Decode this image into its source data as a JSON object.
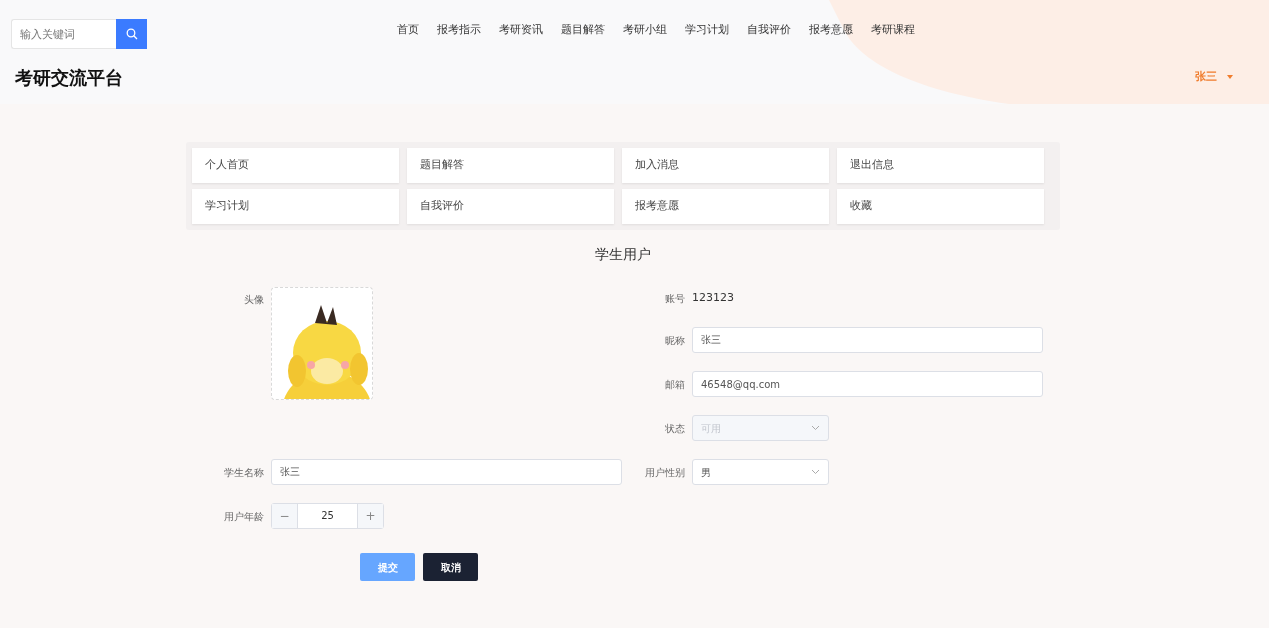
{
  "header": {
    "search": {
      "placeholder": "输入关键词"
    },
    "nav": [
      {
        "label": "首页"
      },
      {
        "label": "报考指示"
      },
      {
        "label": "考研资讯"
      },
      {
        "label": "题目解答"
      },
      {
        "label": "考研小组"
      },
      {
        "label": "学习计划"
      },
      {
        "label": "自我评价"
      },
      {
        "label": "报考意愿"
      },
      {
        "label": "考研课程"
      }
    ],
    "site_title": "考研交流平台",
    "user": "张三"
  },
  "menu": [
    {
      "label": "个人首页"
    },
    {
      "label": "题目解答"
    },
    {
      "label": "加入消息"
    },
    {
      "label": "退出信息"
    },
    {
      "label": "学习计划"
    },
    {
      "label": "自我评价"
    },
    {
      "label": "报考意愿"
    },
    {
      "label": "收藏"
    }
  ],
  "section_title": "学生用户",
  "profile": {
    "avatar": {
      "label": "头像",
      "kind": "picture"
    },
    "account": {
      "label": "账号",
      "value": "123123"
    },
    "nickname": {
      "label": "昵称",
      "value": "张三"
    },
    "email": {
      "label": "邮箱",
      "value": "46548@qq.com"
    },
    "status": {
      "label": "状态",
      "value": "可用",
      "disabled": true
    },
    "student_name": {
      "label": "学生名称",
      "value": "张三"
    },
    "gender": {
      "label": "用户性别",
      "value": "男",
      "disabled": false
    },
    "age": {
      "label": "用户年龄",
      "value": "25",
      "decrement": "−",
      "increment": "+"
    }
  },
  "buttons": [
    {
      "label": "提交",
      "kind": "primary"
    },
    {
      "label": "取消",
      "kind": "dark"
    }
  ]
}
